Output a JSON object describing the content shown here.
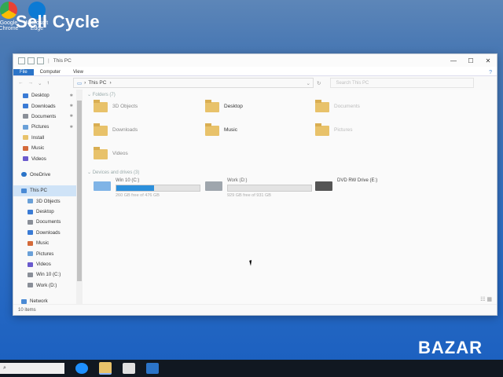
{
  "desktop": {
    "watermark": "Sell Cycle",
    "icons": [
      {
        "label": "Google Chrome",
        "icon": "chrome-icon",
        "color": "#e94235"
      },
      {
        "label": "Microsoft Edge",
        "icon": "edge-icon",
        "color": "#0c7ad4"
      }
    ],
    "corner_watermark": "BAZAR"
  },
  "window": {
    "title": "This PC",
    "controls": [
      "—",
      "☐",
      "✕"
    ]
  },
  "ribbon": {
    "tabs": [
      "File",
      "Computer",
      "View"
    ],
    "help": "?"
  },
  "address_bar": {
    "path": "This PC",
    "search_placeholder": "Search This PC"
  },
  "navigation_pane": {
    "quick_access": [
      {
        "label": "Desktop",
        "icon": "desktop-icon",
        "pinned": true,
        "color": "#3a7bd5"
      },
      {
        "label": "Downloads",
        "icon": "downloads-icon",
        "pinned": true,
        "color": "#3a7bd5"
      },
      {
        "label": "Documents",
        "icon": "documents-icon",
        "pinned": true,
        "color": "#8a8f98"
      },
      {
        "label": "Pictures",
        "icon": "pictures-icon",
        "pinned": true,
        "color": "#6aa0d8"
      },
      {
        "label": "Install",
        "icon": "folder-icon",
        "pinned": false,
        "color": "#e8c26a"
      },
      {
        "label": "Music",
        "icon": "music-icon",
        "pinned": false,
        "color": "#d46a3a"
      },
      {
        "label": "Videos",
        "icon": "videos-icon",
        "pinned": false,
        "color": "#6a5acd"
      }
    ],
    "onedrive": {
      "label": "OneDrive",
      "icon": "onedrive-icon",
      "color": "#2b74c8"
    },
    "this_pc": {
      "label": "This PC",
      "icon": "computer-icon",
      "color": "#4a8ad4"
    },
    "this_pc_items": [
      {
        "label": "3D Objects",
        "icon": "3d-objects-icon",
        "color": "#6aa0d8"
      },
      {
        "label": "Desktop",
        "icon": "desktop-icon",
        "color": "#3a7bd5"
      },
      {
        "label": "Documents",
        "icon": "documents-icon",
        "color": "#8a8f98"
      },
      {
        "label": "Downloads",
        "icon": "downloads-icon",
        "color": "#3a7bd5"
      },
      {
        "label": "Music",
        "icon": "music-icon",
        "color": "#d46a3a"
      },
      {
        "label": "Pictures",
        "icon": "pictures-icon",
        "color": "#6aa0d8"
      },
      {
        "label": "Videos",
        "icon": "videos-icon",
        "color": "#6a5acd"
      },
      {
        "label": "Win 10 (C:)",
        "icon": "drive-icon",
        "color": "#8a8f98"
      },
      {
        "label": "Work (D:)",
        "icon": "drive-icon",
        "color": "#8a8f98"
      }
    ],
    "network": {
      "label": "Network",
      "icon": "network-icon",
      "color": "#4a8ad4"
    }
  },
  "content": {
    "folders_header": "Folders (7)",
    "folders": [
      {
        "label": "3D Objects"
      },
      {
        "label": "Desktop"
      },
      {
        "label": "Documents"
      },
      {
        "label": "Downloads"
      },
      {
        "label": "Music"
      },
      {
        "label": "Pictures"
      },
      {
        "label": "Videos"
      }
    ],
    "drives_header": "Devices and drives (3)",
    "drives": [
      {
        "label": "Win 10 (C:)",
        "free": "260 GB free of 476 GB",
        "used_fraction": 0.45,
        "icon": "windows-drive-icon"
      },
      {
        "label": "Work (D:)",
        "free": "929 GB free of 931 GB",
        "used_fraction": 0.0,
        "icon": "drive-icon"
      },
      {
        "label": "DVD RW Drive (E:)",
        "free": "",
        "used_fraction": null,
        "icon": "dvd-drive-icon"
      }
    ]
  },
  "status_bar": {
    "items_count": "10 items"
  },
  "taskbar": {
    "apps": [
      {
        "icon": "edge-icon",
        "color": "#1e90ff"
      },
      {
        "icon": "file-explorer-icon",
        "color": "#e8c26a"
      },
      {
        "icon": "store-icon",
        "color": "#e0e0e0"
      },
      {
        "icon": "mail-icon",
        "color": "#2b74c8"
      }
    ]
  }
}
